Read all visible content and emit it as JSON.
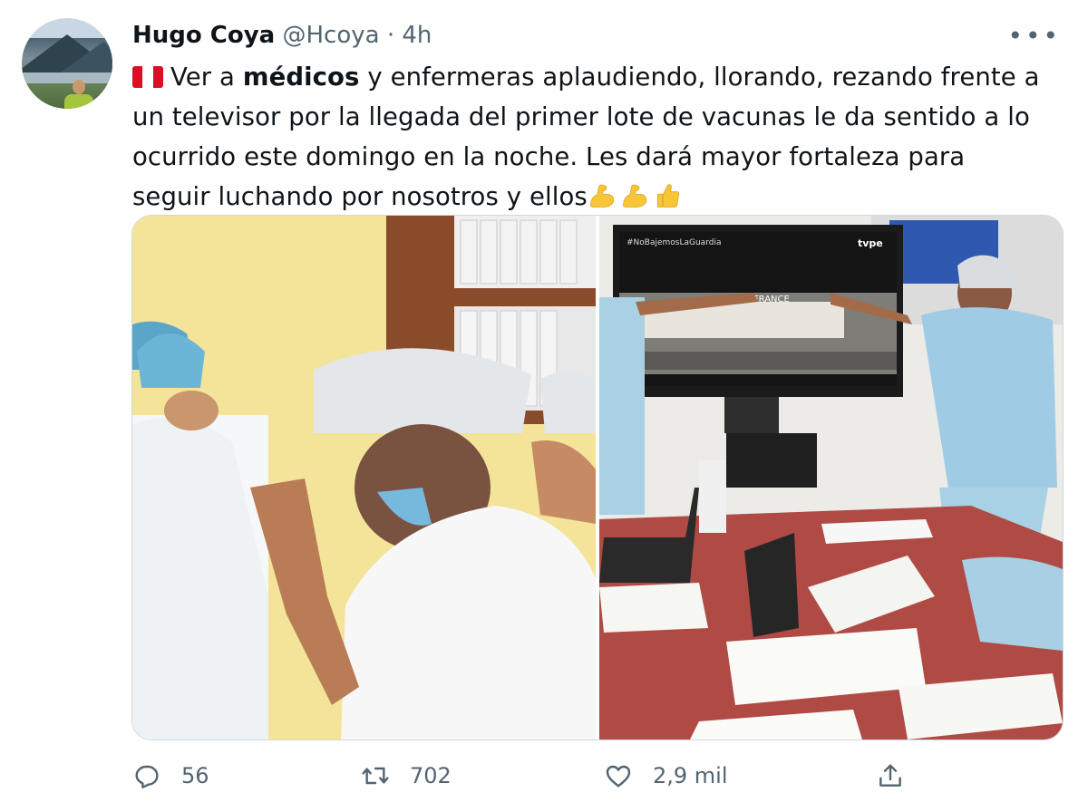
{
  "tweet": {
    "author": {
      "name": "Hugo Coya",
      "handle": "@Hcoya",
      "time": "4h"
    },
    "text": {
      "prefix": "Ver a ",
      "bold": "médicos",
      "body": " y enfermeras aplaudiendo, llorando, rezando frente a un televisor por la llegada del primer lote de vacunas le da sentido a lo ocurrido este domingo en la noche. Les dará mayor fortaleza para seguir luchando por nosotros y ellos"
    },
    "emojis": [
      "flag-peru-icon",
      "flexed-biceps-icon",
      "flexed-biceps-icon",
      "thumbs-up-icon"
    ],
    "media": {
      "left_photo": {
        "alt": ""
      },
      "right_photo": {
        "tv_logo": "tvpe",
        "tv_hashtag": "#NoBajemosLaGuardia",
        "tv_plane_text": "AIR FRANCE"
      }
    },
    "actions": {
      "reply_count": "56",
      "retweet_count": "702",
      "like_count": "2,9 mil"
    }
  },
  "colors": {
    "text": "#0f1419",
    "muted": "#536471",
    "border": "#cfd9de",
    "flag_red": "#d91023",
    "emoji_yellow": "#f6c636"
  }
}
